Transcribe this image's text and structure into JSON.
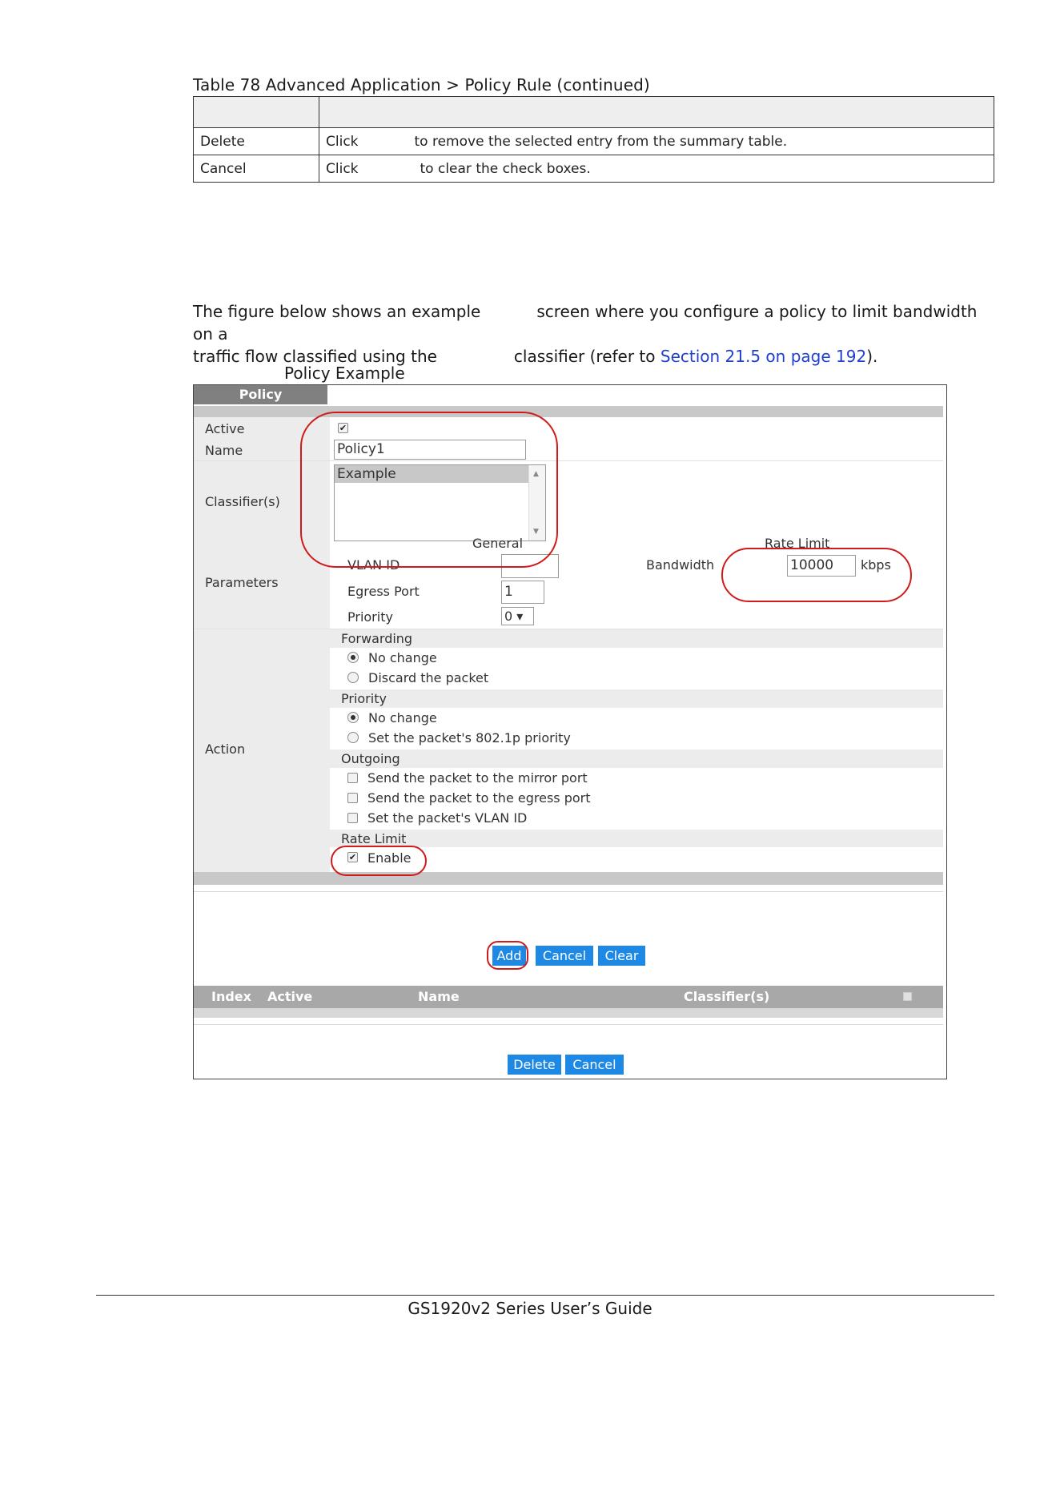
{
  "table": {
    "caption": "Table 78   Advanced Application > Policy Rule  (continued)",
    "header": [
      "",
      ""
    ],
    "rows": [
      {
        "label": "Delete",
        "click": "Click",
        "desc": "to remove the selected entry from the summary table."
      },
      {
        "label": "Cancel",
        "click": "Click",
        "desc": "to clear the check boxes."
      }
    ]
  },
  "paragraph": {
    "line1_a": "The figure below shows an example",
    "line1_b": "screen where you configure a policy to limit bandwidth on a",
    "line2_a": "traffic flow classified using the",
    "line2_b": "classifier (refer to ",
    "link": "Section 21.5 on page 192",
    "line2_c": ")."
  },
  "figure_caption": "Policy Example",
  "policy": {
    "tab": "Policy",
    "active_label": "Active",
    "active_checked": true,
    "name_label": "Name",
    "name_value": "Policy1",
    "classifiers_label": "Classifier(s)",
    "classifier_options": [
      "Example"
    ],
    "parameters_label": "Parameters",
    "general_heading": "General",
    "rate_limit_heading": "Rate Limit",
    "vlan_id_label": "VLAN ID",
    "vlan_id_value": "",
    "egress_port_label": "Egress Port",
    "egress_port_value": "1",
    "priority_label": "Priority",
    "priority_value": "0 ▾",
    "bandwidth_label": "Bandwidth",
    "bandwidth_value": "10000",
    "bandwidth_unit": "kbps",
    "action_label": "Action",
    "forwarding_heading": "Forwarding",
    "forwarding_options": [
      "No change",
      "Discard the packet"
    ],
    "priority_heading": "Priority",
    "priority_options": [
      "No change",
      "Set the packet's 802.1p priority"
    ],
    "outgoing_heading": "Outgoing",
    "outgoing_options": [
      "Send the packet to the mirror port",
      "Send the packet to the egress port",
      "Set the packet's VLAN ID"
    ],
    "rate_limit_section": "Rate Limit",
    "enable_label": "Enable",
    "enable_checked": true,
    "buttons": {
      "add": "Add",
      "cancel": "Cancel",
      "clear": "Clear",
      "delete": "Delete",
      "cancel2": "Cancel"
    },
    "summary_columns": [
      "Index",
      "Active",
      "Name",
      "Classifier(s)"
    ],
    "highlight_color": "#d11a1a",
    "button_color": "#1e88e5"
  },
  "footer": "GS1920v2 Series User’s Guide"
}
